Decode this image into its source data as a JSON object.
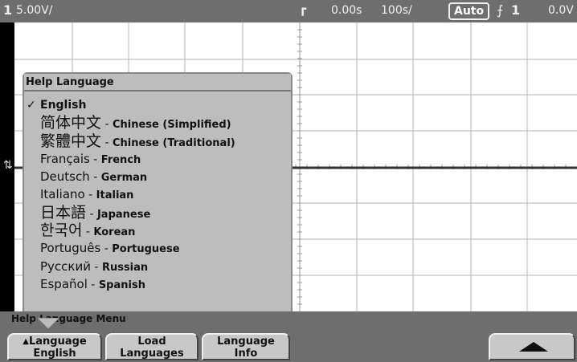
{
  "status_bar": {
    "channel": "1",
    "volts_per_div": "5.00V/",
    "trigger_marker": "⌐",
    "time_offset": "0.00s",
    "time_per_div": "100s/",
    "trigger_mode": "Auto",
    "trigger_slope": "⨍",
    "trigger_source": "1",
    "trigger_level": "0.0V"
  },
  "channel_marker": "⇅",
  "help_popup": {
    "title": "Help Language",
    "check": "✓",
    "separator": " - ",
    "languages": [
      {
        "native": "",
        "english": "English",
        "selected": true
      },
      {
        "native": "简体中文",
        "english": "Chinese (Simplified)",
        "selected": false
      },
      {
        "native": "繁體中文",
        "english": "Chinese (Traditional)",
        "selected": false
      },
      {
        "native": "Français",
        "english": "French",
        "selected": false
      },
      {
        "native": "Deutsch",
        "english": "German",
        "selected": false
      },
      {
        "native": "Italiano",
        "english": "Italian",
        "selected": false
      },
      {
        "native": "日本語",
        "english": "Japanese",
        "selected": false
      },
      {
        "native": "한국어",
        "english": "Korean",
        "selected": false
      },
      {
        "native": "Português",
        "english": "Portuguese",
        "selected": false
      },
      {
        "native": "Русский",
        "english": "Russian",
        "selected": false
      },
      {
        "native": "Español",
        "english": "Spanish",
        "selected": false
      }
    ]
  },
  "menu": {
    "title": "Help Language Menu",
    "softkeys": {
      "language_line1": "Language",
      "language_line2": "English",
      "load_line1": "Load",
      "load_line2": "Languages",
      "info_line1": "Language",
      "info_line2": "Info"
    },
    "language_softkey_icon": "up-triangle",
    "return_icon": "up-arrow"
  },
  "colors": {
    "status_bar_bg": "#6e6e6e",
    "graticule_bg": "#ffffff",
    "popup_bg": "#bdbdbd",
    "trace": "#333333"
  }
}
